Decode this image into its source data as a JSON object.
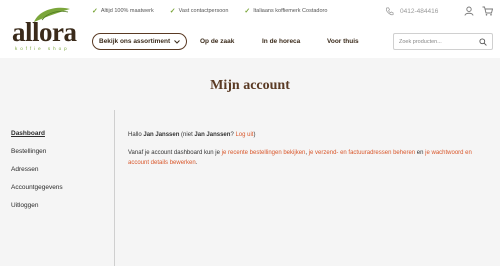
{
  "header": {
    "logo": {
      "word": "allora",
      "tagline": "koffie shop"
    },
    "usps": [
      "Altijd 100% maatwerk",
      "Vast contactpersoon",
      "Italiaans koffiemerk Costadoro"
    ],
    "phone": "0412-484416",
    "icons": [
      "phone-icon",
      "user-icon",
      "cart-icon"
    ]
  },
  "nav": {
    "assortment_label": "Bekijk ons assortiment",
    "links": [
      "Op de zaak",
      "In de horeca",
      "Voor thuis"
    ],
    "search_placeholder": "Zoek producten..."
  },
  "page": {
    "title": "Mijn account"
  },
  "sidebar": {
    "items": [
      "Dashboard",
      "Bestellingen",
      "Adressen",
      "Accountgegevens",
      "Uitloggen"
    ],
    "active": "Dashboard"
  },
  "dashboard": {
    "greeting_prefix": "Hallo",
    "user_name": "Jan Janssen",
    "not_prefix": " (niet",
    "not_name": "Jan Janssen",
    "not_suffix": "?",
    "logout_link": "Log uit",
    "close_paren": ")",
    "intro": "Vanaf je account dashboard kun je",
    "orders_link": "je recente bestellingen bekijken",
    "comma": ",",
    "addresses_link": "je verzend- en factuuradressen beheren",
    "and": "en",
    "account_link": "je wachtwoord en account details bewerken",
    "period": "."
  },
  "colors": {
    "brand_brown": "#5a3a24",
    "brand_green": "#7ba63b",
    "link_orange": "#d9572b",
    "band_grey": "#f5f5f5"
  }
}
